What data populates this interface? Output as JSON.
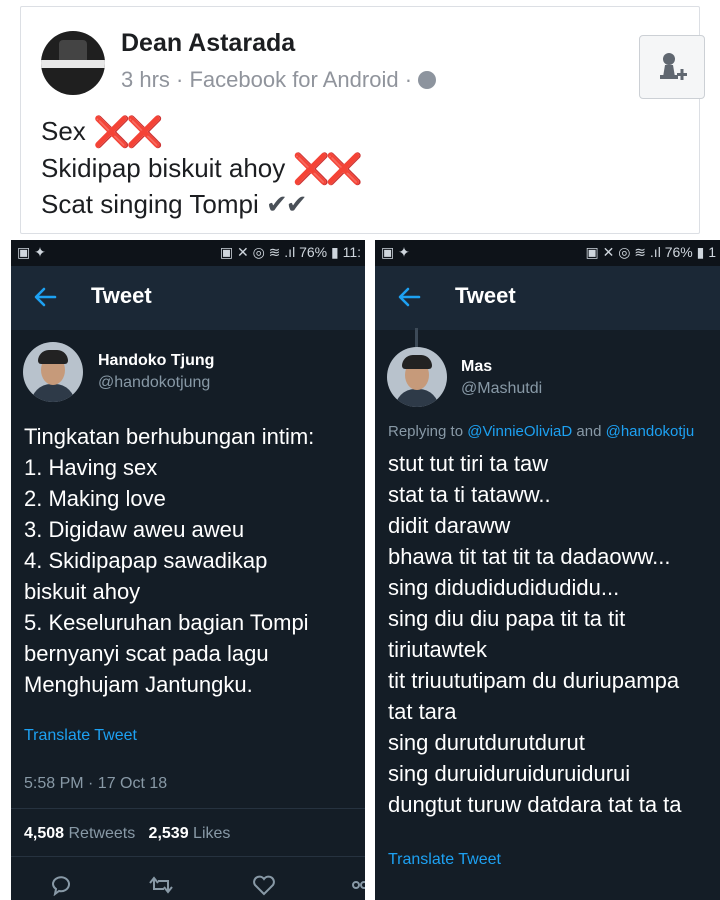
{
  "post": {
    "author": "Dean Astarada",
    "meta": "3 hrs · Facebook for Android ·",
    "lines": [
      {
        "text": "Sex",
        "mark": "❌❌"
      },
      {
        "text": "Skidipap biskuit ahoy",
        "mark": "❌❌"
      },
      {
        "text": "Scat singing Tompi",
        "mark": "✔✔"
      }
    ],
    "icons": {
      "add_friend": "add-friend-icon",
      "privacy": "globe-icon"
    }
  },
  "left_phone": {
    "status_left": "▣ ✦",
    "status_right": "▣ ✕ ◎ ≋ .ıl 76% ▮ 11:",
    "nav_title": "Tweet",
    "author_name": "Handoko Tjung",
    "author_handle": "@handokotjung",
    "tweet_lines": [
      "Tingkatan berhubungan intim:",
      "1. Having sex",
      "2. Making love",
      "3. Digidaw aweu aweu",
      "4. Skidipapap sawadikap",
      "biskuit ahoy",
      "5. Keseluruhan bagian Tompi",
      "bernyanyi scat pada lagu",
      "Menghujam Jantungku."
    ],
    "translate": "Translate Tweet",
    "timestamp": "5:58 PM · 17 Oct 18",
    "retweets_count": "4,508",
    "retweets_label": "Retweets",
    "likes_count": "2,539",
    "likes_label": "Likes",
    "actions": [
      "reply-icon",
      "retweet-icon",
      "like-icon",
      "share-icon"
    ]
  },
  "right_phone": {
    "status_left": "▣ ✦",
    "status_right": "▣ ✕ ◎ ≋ .ıl 76% ▮ 1",
    "nav_title": "Tweet",
    "author_name": "Mas",
    "author_handle": "@Mashutdi",
    "replying_prefix": "Replying to",
    "replying_user1": "@VinnieOliviaD",
    "replying_and": "and",
    "replying_user2": "@handokotju",
    "tweet_lines": [
      "stut tut tiri ta taw",
      "stat ta ti tataww..",
      "didit daraww",
      "bhawa tit tat tit ta dadaoww...",
      "sing didudidudidudidu...",
      "sing diu diu papa tit ta tit",
      "tiriutawtek",
      "tit triuututipam du duriupampa",
      "tat tara",
      "sing durutdurutdurut",
      "sing duruiduruiduruidurui",
      "dungtut turuw datdara tat ta ta"
    ],
    "translate": "Translate Tweet"
  },
  "colors": {
    "twitter_bg": "#141d26",
    "twitter_nav": "#1b2836",
    "link_blue": "#1da1f2",
    "muted": "#8899a6",
    "cross_red": "#e0245e"
  }
}
